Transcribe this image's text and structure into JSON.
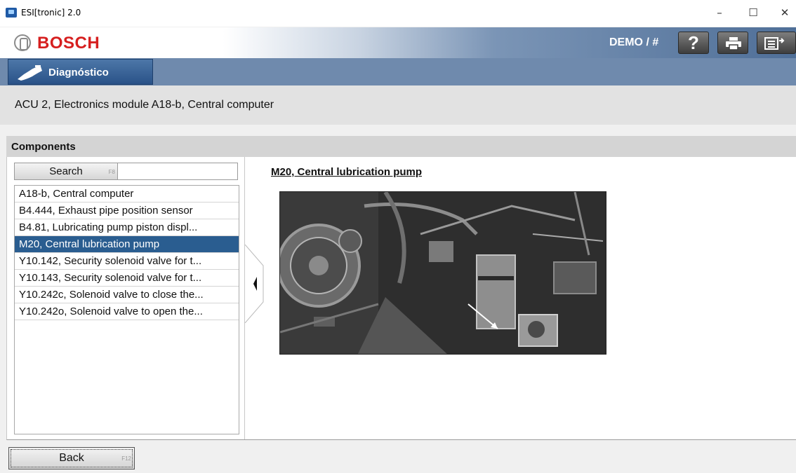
{
  "window": {
    "title": "ESI[tronic] 2.0",
    "controls": {
      "minimize": "–",
      "maximize": "☐",
      "close": "✕"
    }
  },
  "header": {
    "brand": "BOSCH",
    "user": "DEMO / #",
    "help_label": "?",
    "buttons": [
      "help-icon",
      "print-icon",
      "export-icon"
    ]
  },
  "nav": {
    "tab_label": "Diagnóstico",
    "tab_icon": "diagnostic-plug-icon"
  },
  "breadcrumb": "ACU 2, Electronics module A18-b, Central computer",
  "components": {
    "title": "Components",
    "search_label": "Search",
    "search_fkey": "F8",
    "search_value": "",
    "items": [
      {
        "label": "A18-b, Central computer",
        "selected": false
      },
      {
        "label": "B4.444, Exhaust pipe position sensor",
        "selected": false
      },
      {
        "label": "B4.81, Lubricating pump piston displ...",
        "selected": false
      },
      {
        "label": "M20, Central lubrication pump",
        "selected": true
      },
      {
        "label": "Y10.142, Security solenoid valve for t...",
        "selected": false
      },
      {
        "label": "Y10.143, Security solenoid valve for t...",
        "selected": false
      },
      {
        "label": "Y10.242c, Solenoid valve to close the...",
        "selected": false
      },
      {
        "label": "Y10.242o, Solenoid valve to open the...",
        "selected": false
      }
    ]
  },
  "detail": {
    "title": "M20, Central lubrication pump"
  },
  "footer": {
    "back_label": "Back",
    "back_fkey": "F12"
  },
  "colors": {
    "brand_red": "#d61f1f",
    "nav_blue": "#2a5288",
    "selection": "#2a5d90"
  }
}
